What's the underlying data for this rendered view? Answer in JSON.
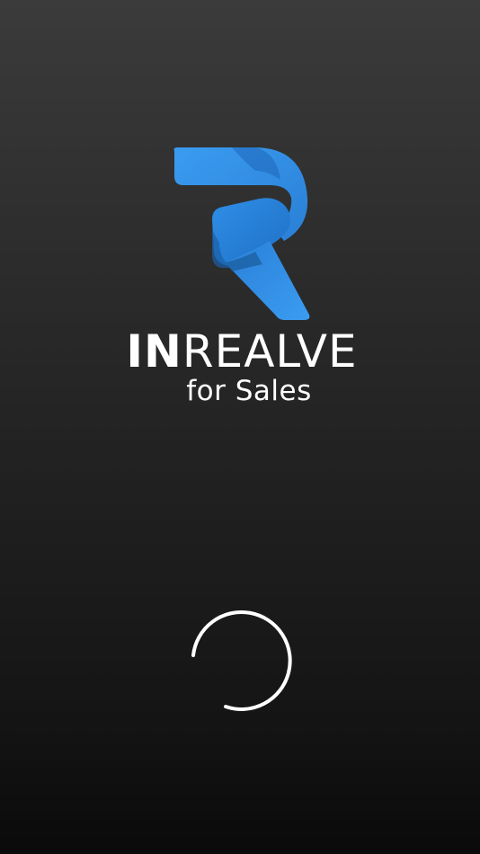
{
  "app": {
    "brand_bold": "IN",
    "brand_light": "REALVE",
    "tagline": "for Sales"
  },
  "logo": {
    "icon": "inrealve-r-logo-icon",
    "colors": {
      "primary": "#2e86e0",
      "light": "#3a9cf0",
      "dark": "#1a5fa8"
    }
  },
  "loading": {
    "icon": "loading-spinner-icon",
    "color": "#ffffff"
  },
  "theme": {
    "background_top": "#3b3b3b",
    "background_bottom": "#0a0a0a",
    "text_color": "#ffffff"
  }
}
